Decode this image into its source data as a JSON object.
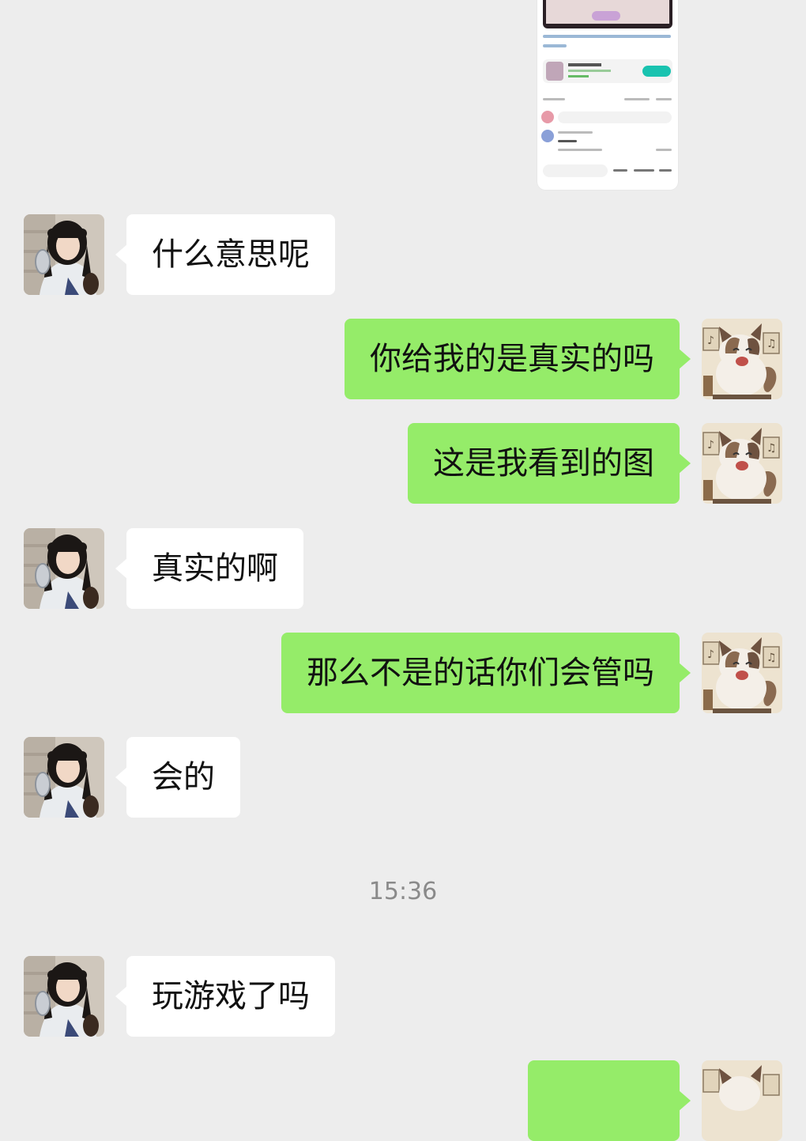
{
  "messages": [
    {
      "side": "in",
      "text": "什么意思呢"
    },
    {
      "side": "out",
      "text": "你给我的是真实的吗"
    },
    {
      "side": "out",
      "text": "这是我看到的图"
    },
    {
      "side": "in",
      "text": "真实的啊"
    },
    {
      "side": "out",
      "text": "那么不是的话你们会管吗"
    },
    {
      "side": "in",
      "text": "会的"
    },
    {
      "side": "in",
      "text": "玩游戏了吗"
    }
  ],
  "timestamp": "15:36",
  "avatars": {
    "contact": "girl-photo-avatar",
    "self": "cartoon-cat-avatar"
  },
  "colors": {
    "background": "#ededed",
    "incoming_bubble": "#ffffff",
    "outgoing_bubble": "#95ec69",
    "timestamp_text": "#8a8a8a"
  }
}
